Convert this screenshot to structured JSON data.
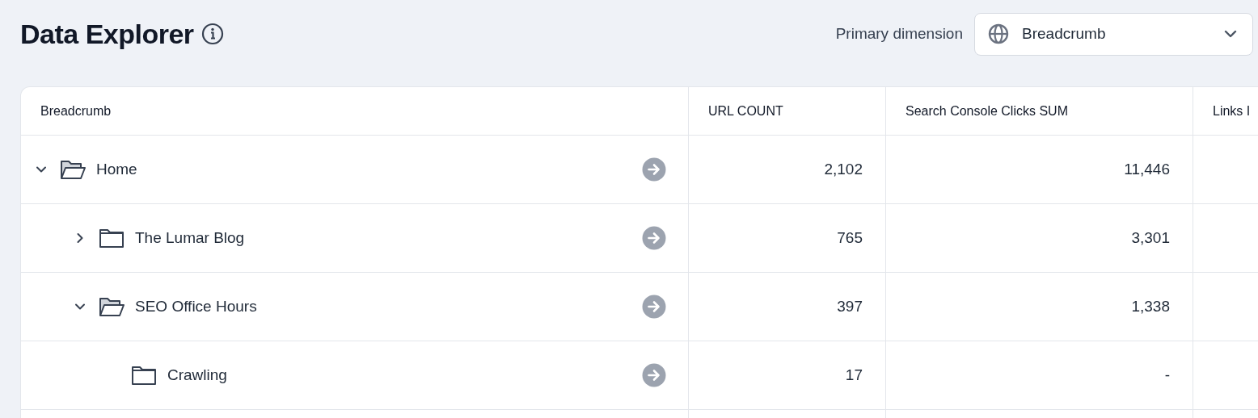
{
  "page": {
    "title": "Data Explorer"
  },
  "primary_dimension": {
    "label": "Primary dimension",
    "value": "Breadcrumb"
  },
  "table": {
    "columns": [
      "Breadcrumb",
      "URL COUNT",
      "Search Console Clicks SUM",
      "Links I"
    ],
    "rows": [
      {
        "name": "Home",
        "expanded": true,
        "url_count": "2,102",
        "clicks": "11,446",
        "children": [
          {
            "name": "The Lumar Blog",
            "expanded": false,
            "url_count": "765",
            "clicks": "3,301"
          },
          {
            "name": "SEO Office Hours",
            "expanded": true,
            "url_count": "397",
            "clicks": "1,338",
            "children": [
              {
                "name": "Crawling",
                "url_count": "17",
                "clicks": "-"
              }
            ]
          }
        ]
      }
    ]
  }
}
